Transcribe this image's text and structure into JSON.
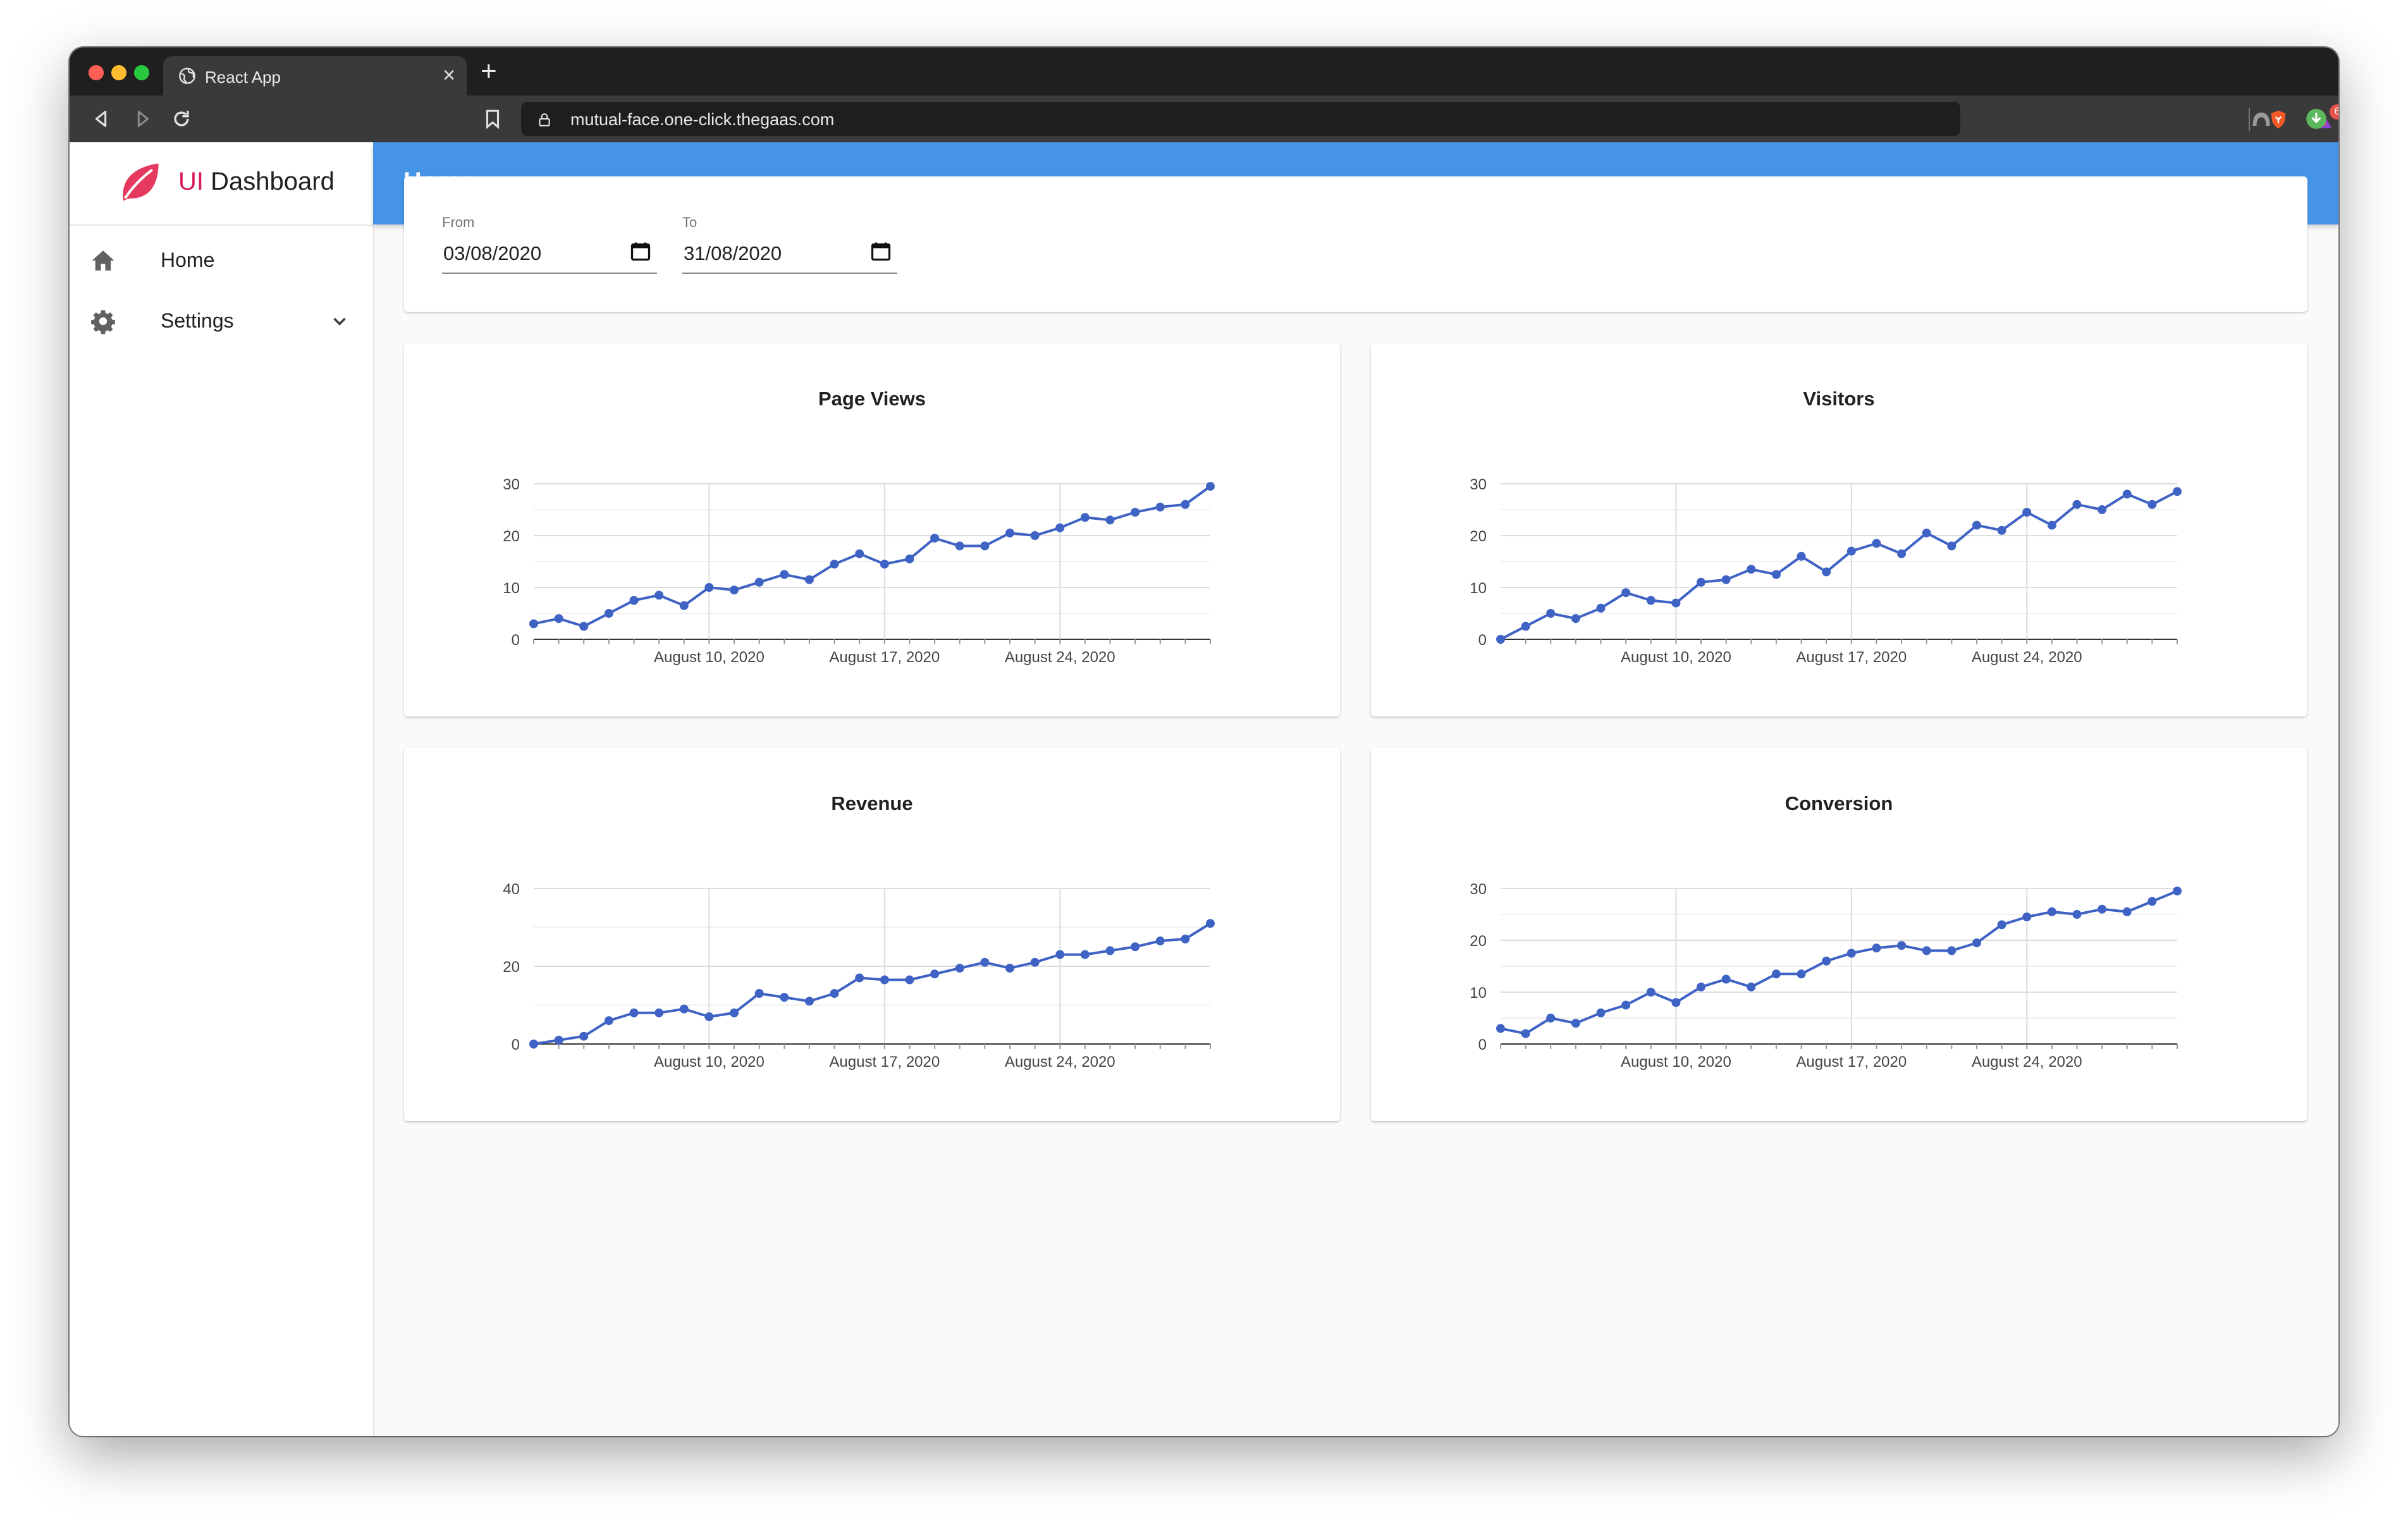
{
  "browser": {
    "tab_title": "React App",
    "tab_close": "×",
    "new_tab": "+",
    "url": "mutual-face.one-click.thegaas.com",
    "badge_count": "6"
  },
  "colors": {
    "brand_accent": "#d81b60",
    "appbar": "#4594e8",
    "series_line": "#3f63c4"
  },
  "sidebar": {
    "brand_prefix": "UI",
    "brand_name": "Dashboard",
    "items": [
      {
        "label": "Home",
        "icon": "home-icon"
      },
      {
        "label": "Settings",
        "icon": "gear-icon",
        "expandable": true
      }
    ]
  },
  "header": {
    "title": "Home"
  },
  "filters": {
    "from_label": "From",
    "from_value": "03/08/2020",
    "to_label": "To",
    "to_value": "31/08/2020"
  },
  "chart_data": [
    {
      "type": "line",
      "title": "Page Views",
      "x": [
        "2020-08-03",
        "2020-08-04",
        "2020-08-05",
        "2020-08-06",
        "2020-08-07",
        "2020-08-08",
        "2020-08-09",
        "2020-08-10",
        "2020-08-11",
        "2020-08-12",
        "2020-08-13",
        "2020-08-14",
        "2020-08-15",
        "2020-08-16",
        "2020-08-17",
        "2020-08-18",
        "2020-08-19",
        "2020-08-20",
        "2020-08-21",
        "2020-08-22",
        "2020-08-23",
        "2020-08-24",
        "2020-08-25",
        "2020-08-26",
        "2020-08-27",
        "2020-08-28",
        "2020-08-29",
        "2020-08-30"
      ],
      "values": [
        3,
        4,
        2.5,
        5,
        7.5,
        8.5,
        6.5,
        10,
        9.5,
        11,
        12.5,
        11.5,
        14.5,
        16.5,
        14.5,
        15.5,
        19.5,
        18,
        18,
        20.5,
        20,
        21.5,
        23.5,
        23,
        24.5,
        25.5,
        26,
        29.5
      ],
      "ylim": [
        0,
        30
      ],
      "yticks": [
        "0",
        "10",
        "20",
        "30"
      ],
      "xticks": [
        "August 10, 2020",
        "August 17, 2020",
        "August 24, 2020"
      ],
      "grid": true
    },
    {
      "type": "line",
      "title": "Visitors",
      "x": [
        "2020-08-03",
        "2020-08-04",
        "2020-08-05",
        "2020-08-06",
        "2020-08-07",
        "2020-08-08",
        "2020-08-09",
        "2020-08-10",
        "2020-08-11",
        "2020-08-12",
        "2020-08-13",
        "2020-08-14",
        "2020-08-15",
        "2020-08-16",
        "2020-08-17",
        "2020-08-18",
        "2020-08-19",
        "2020-08-20",
        "2020-08-21",
        "2020-08-22",
        "2020-08-23",
        "2020-08-24",
        "2020-08-25",
        "2020-08-26",
        "2020-08-27",
        "2020-08-28",
        "2020-08-29",
        "2020-08-30"
      ],
      "values": [
        0,
        2.5,
        5,
        4,
        6,
        9,
        7.5,
        7,
        11,
        11.5,
        13.5,
        12.5,
        16,
        13,
        17,
        18.5,
        16.5,
        20.5,
        18,
        22,
        21,
        24.5,
        22,
        26,
        25,
        28,
        26,
        28.5
      ],
      "ylim": [
        0,
        30
      ],
      "yticks": [
        "0",
        "10",
        "20",
        "30"
      ],
      "xticks": [
        "August 10, 2020",
        "August 17, 2020",
        "August 24, 2020"
      ],
      "grid": true
    },
    {
      "type": "line",
      "title": "Revenue",
      "x": [
        "2020-08-03",
        "2020-08-04",
        "2020-08-05",
        "2020-08-06",
        "2020-08-07",
        "2020-08-08",
        "2020-08-09",
        "2020-08-10",
        "2020-08-11",
        "2020-08-12",
        "2020-08-13",
        "2020-08-14",
        "2020-08-15",
        "2020-08-16",
        "2020-08-17",
        "2020-08-18",
        "2020-08-19",
        "2020-08-20",
        "2020-08-21",
        "2020-08-22",
        "2020-08-23",
        "2020-08-24",
        "2020-08-25",
        "2020-08-26",
        "2020-08-27",
        "2020-08-28",
        "2020-08-29",
        "2020-08-30"
      ],
      "values": [
        0,
        1,
        2,
        6,
        8,
        8,
        9,
        7,
        8,
        13,
        12,
        11,
        13,
        17,
        16.5,
        16.5,
        18,
        19.5,
        21,
        19.5,
        21,
        23,
        23,
        24,
        25,
        26.5,
        27,
        31
      ],
      "ylim": [
        0,
        40
      ],
      "yticks": [
        "0",
        "20",
        "40"
      ],
      "xticks": [
        "August 10, 2020",
        "August 17, 2020",
        "August 24, 2020"
      ],
      "grid": true
    },
    {
      "type": "line",
      "title": "Conversion",
      "x": [
        "2020-08-03",
        "2020-08-04",
        "2020-08-05",
        "2020-08-06",
        "2020-08-07",
        "2020-08-08",
        "2020-08-09",
        "2020-08-10",
        "2020-08-11",
        "2020-08-12",
        "2020-08-13",
        "2020-08-14",
        "2020-08-15",
        "2020-08-16",
        "2020-08-17",
        "2020-08-18",
        "2020-08-19",
        "2020-08-20",
        "2020-08-21",
        "2020-08-22",
        "2020-08-23",
        "2020-08-24",
        "2020-08-25",
        "2020-08-26",
        "2020-08-27",
        "2020-08-28",
        "2020-08-29",
        "2020-08-30"
      ],
      "values": [
        3,
        2,
        5,
        4,
        6,
        7.5,
        10,
        8,
        11,
        12.5,
        11,
        13.5,
        13.5,
        16,
        17.5,
        18.5,
        19,
        18,
        18,
        19.5,
        23,
        24.5,
        25.5,
        25,
        26,
        25.5,
        27.5,
        29.5
      ],
      "ylim": [
        0,
        30
      ],
      "yticks": [
        "0",
        "10",
        "20",
        "30"
      ],
      "xticks": [
        "August 10, 2020",
        "August 17, 2020",
        "August 24, 2020"
      ],
      "grid": true
    }
  ]
}
